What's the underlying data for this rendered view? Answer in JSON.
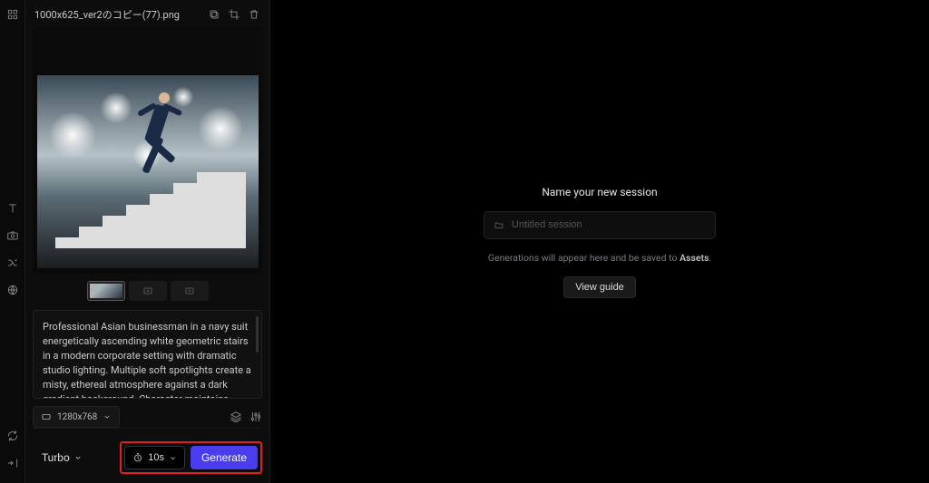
{
  "file": {
    "name": "1000x625_ver2のコピー(77).png"
  },
  "prompt": {
    "text": "Professional Asian businessman in a navy suit energetically ascending white geometric stairs in a modern corporate setting with dramatic studio lighting. Multiple soft spotlights create a misty, ethereal atmosphere against a dark gradient background. Character maintains enthusiastic"
  },
  "resolution": {
    "label": "1280x768"
  },
  "model": {
    "label": "Turbo"
  },
  "duration": {
    "label": "10s"
  },
  "generate": {
    "label": "Generate"
  },
  "main": {
    "title": "Name your new session",
    "placeholder": "Untitled session",
    "hint_prefix": "Generations will appear here and be saved to ",
    "hint_bold": "Assets",
    "hint_suffix": ".",
    "guide_label": "View guide"
  }
}
